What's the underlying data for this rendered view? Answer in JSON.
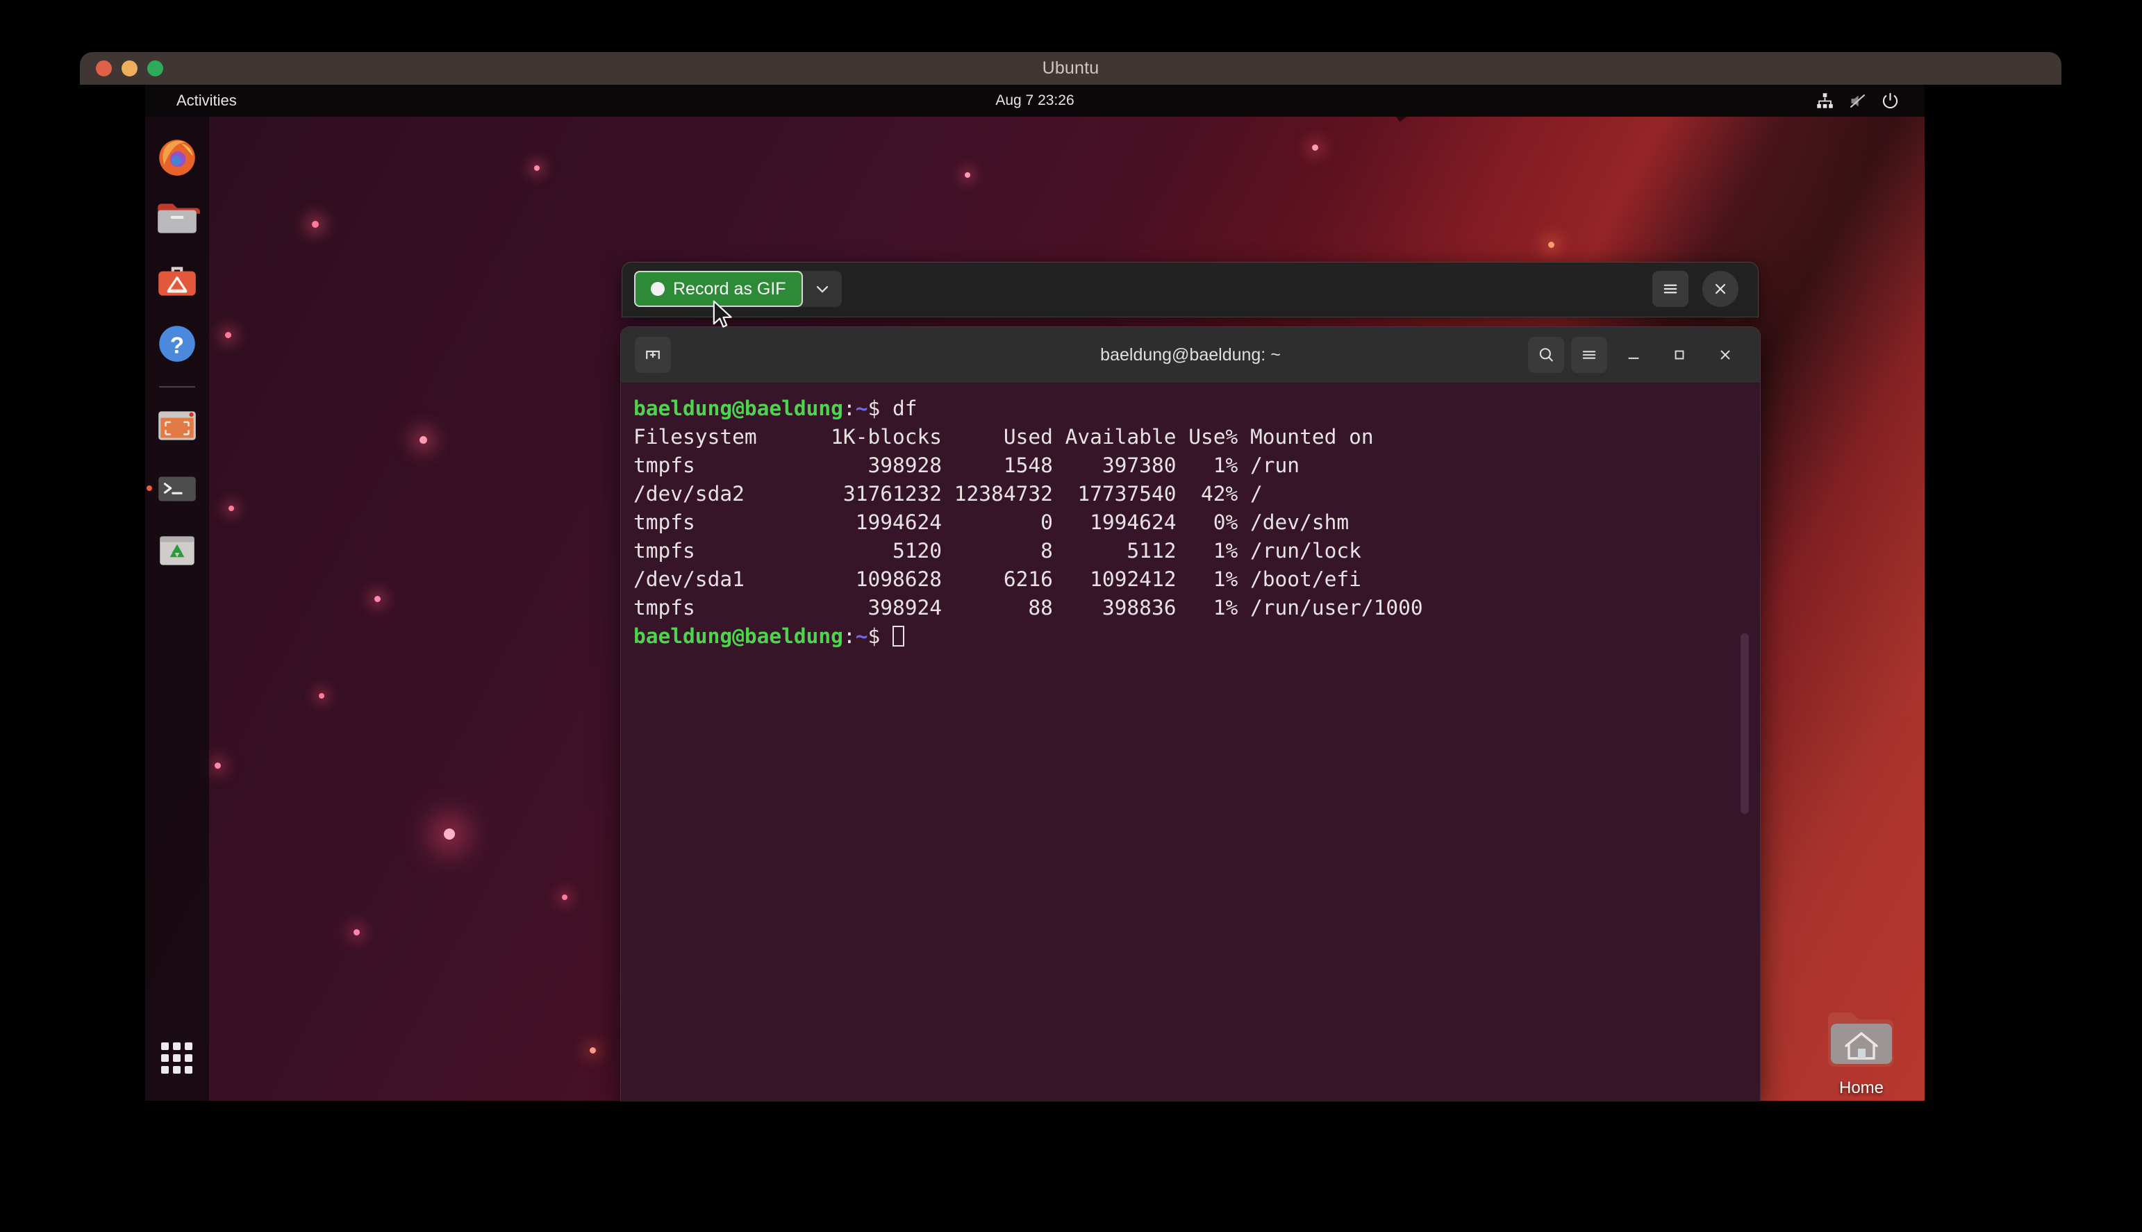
{
  "vm": {
    "title": "Ubuntu",
    "lights": [
      "close",
      "minimize",
      "zoom"
    ]
  },
  "topbar": {
    "activities": "Activities",
    "clock": "Aug 7 23:26",
    "tray": [
      "network-icon",
      "volume-muted-icon",
      "power-icon"
    ]
  },
  "dock": {
    "items": [
      {
        "name": "firefox",
        "label": "Firefox",
        "running": false
      },
      {
        "name": "files",
        "label": "Files",
        "running": false
      },
      {
        "name": "ubuntu-software",
        "label": "Ubuntu Software",
        "running": false
      },
      {
        "name": "help",
        "label": "Help",
        "running": false
      },
      {
        "name": "app-window",
        "label": "Screenshot",
        "running": false
      },
      {
        "name": "terminal",
        "label": "Terminal",
        "running": true
      },
      {
        "name": "trash",
        "label": "Trash",
        "running": false
      }
    ],
    "apps_button": "show-applications"
  },
  "desktop": {
    "home_icon_label": "Home"
  },
  "recorder": {
    "record_label": "Record as GIF",
    "caret": "chevron-down-icon",
    "menu": "hamburger-icon",
    "close": "close-icon",
    "accent": "#2d8a36"
  },
  "terminal": {
    "title": "baeldung@baeldung: ~",
    "new_tab": "new-tab-icon",
    "controls": [
      "search-icon",
      "hamburger-icon",
      "minimize",
      "maximize",
      "close"
    ],
    "background": "#371529",
    "prompt_user": "baeldung@baeldung",
    "prompt_path": "~",
    "prompt_sym": "$",
    "command": "df",
    "output": {
      "headers": [
        "Filesystem",
        "1K-blocks",
        "Used",
        "Available",
        "Use%",
        "Mounted on"
      ],
      "rows": [
        [
          "tmpfs",
          "398928",
          "1548",
          "397380",
          "1%",
          "/run"
        ],
        [
          "/dev/sda2",
          "31761232",
          "12384732",
          "17737540",
          "42%",
          "/"
        ],
        [
          "tmpfs",
          "1994624",
          "0",
          "1994624",
          "0%",
          "/dev/shm"
        ],
        [
          "tmpfs",
          "5120",
          "8",
          "5112",
          "1%",
          "/run/lock"
        ],
        [
          "/dev/sda1",
          "1098628",
          "6216",
          "1092412",
          "1%",
          "/boot/efi"
        ],
        [
          "tmpfs",
          "398924",
          "88",
          "398836",
          "1%",
          "/run/user/1000"
        ]
      ],
      "lines": [
        "Filesystem      1K-blocks     Used Available Use% Mounted on",
        "tmpfs              398928     1548    397380   1% /run",
        "/dev/sda2        31761232 12384732  17737540  42% /",
        "tmpfs             1994624        0   1994624   0% /dev/shm",
        "tmpfs                5120        8      5112   1% /run/lock",
        "/dev/sda1         1098628     6216   1092412   1% /boot/efi",
        "tmpfs              398924       88    398836   1% /run/user/1000"
      ]
    }
  }
}
